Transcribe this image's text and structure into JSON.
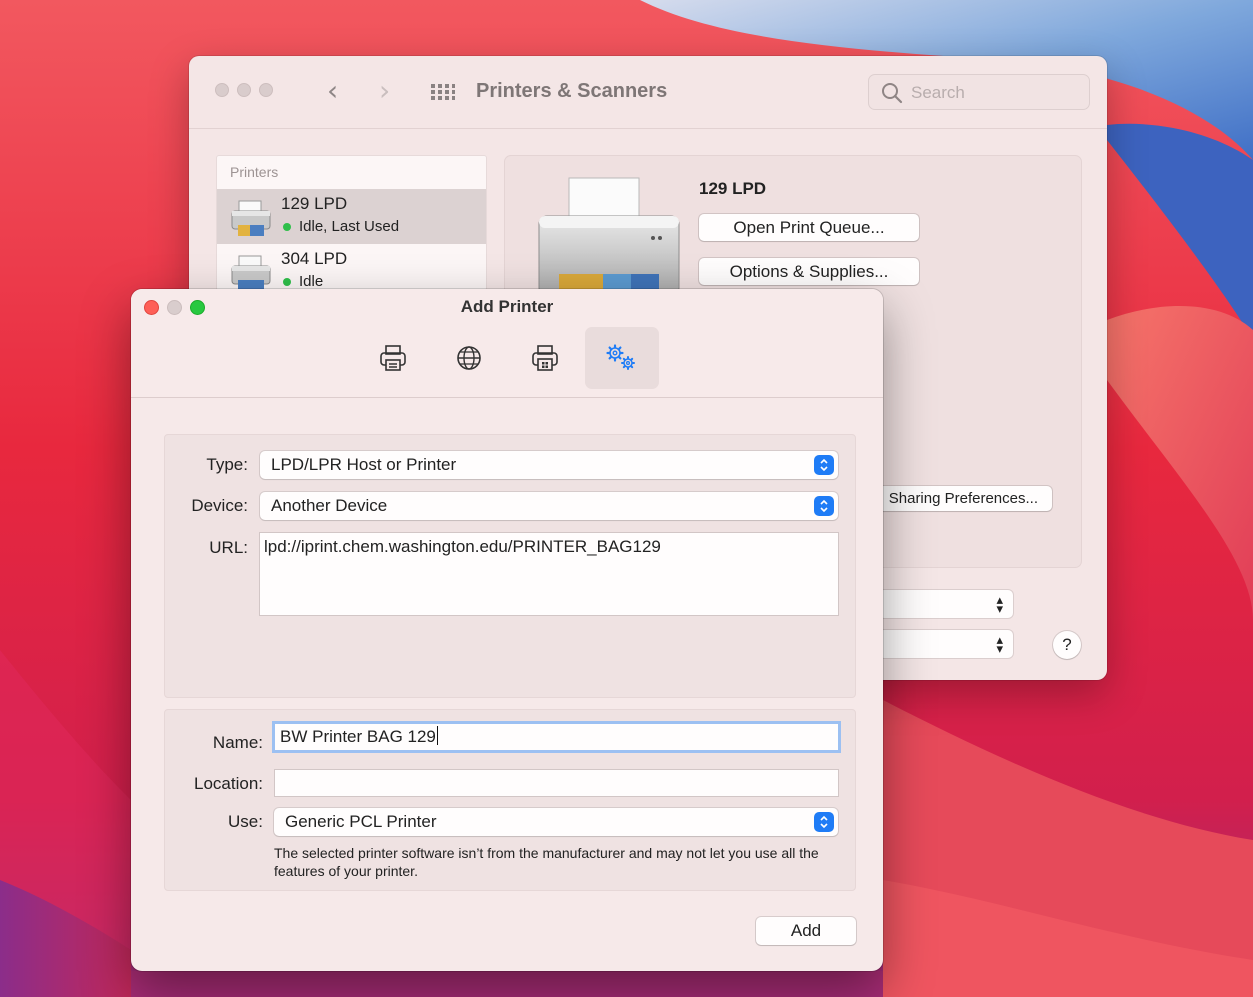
{
  "printers_window": {
    "title": "Printers & Scanners",
    "search_placeholder": "Search",
    "list_header": "Printers",
    "printers": [
      {
        "name": "129 LPD",
        "status": "Idle, Last Used",
        "selected": true
      },
      {
        "name": "304 LPD",
        "status": "Idle",
        "selected": false
      }
    ],
    "detail": {
      "printer_name": "129 LPD",
      "open_queue_label": "Open Print Queue...",
      "options_label": "Options & Supplies...",
      "sharing_label": "Sharing Preferences..."
    },
    "help_label": "?"
  },
  "add_printer": {
    "title": "Add Printer",
    "toolbar": [
      {
        "name": "default-printer",
        "icon": "printer-icon",
        "active": false
      },
      {
        "name": "ip-printer",
        "icon": "globe-icon",
        "active": false
      },
      {
        "name": "windows-printer",
        "icon": "windows-printer-icon",
        "active": false
      },
      {
        "name": "advanced",
        "icon": "gears-icon",
        "active": true
      }
    ],
    "type_label": "Type:",
    "type_value": "LPD/LPR Host or Printer",
    "device_label": "Device:",
    "device_value": "Another Device",
    "url_label": "URL:",
    "url_value": "lpd://iprint.chem.washington.edu/PRINTER_BAG129",
    "name_label": "Name:",
    "name_value": "BW Printer BAG 129",
    "location_label": "Location:",
    "location_value": "",
    "use_label": "Use:",
    "use_value": "Generic PCL Printer",
    "note": "The selected printer software isn’t from the manufacturer and may not let you use all the features of your printer.",
    "add_button_label": "Add"
  },
  "colors": {
    "accent": "#1f7cf6",
    "status_idle": "#2fbf4a",
    "close": "#fe5f57",
    "maximize": "#28c840"
  }
}
